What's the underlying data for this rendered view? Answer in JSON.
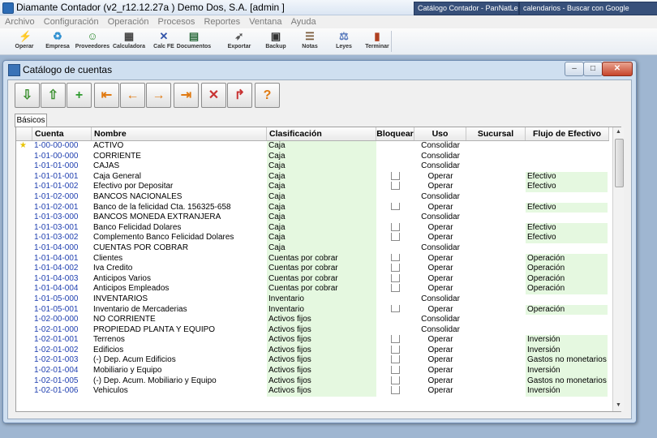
{
  "app": {
    "title": "Diamante Contador (v2_r12.12.27a ) Demo Dos, S.A.  [admin ]",
    "browser_tabs": [
      "Catálogo Contador - PanNatLeo...",
      "calendarios - Buscar con Google"
    ]
  },
  "menu": [
    "Archivo",
    "Configuración",
    "Operación",
    "Procesos",
    "Reportes",
    "Ventana",
    "Ayuda"
  ],
  "toolbar": [
    {
      "label": "Operar",
      "icon": "lightning-icon"
    },
    {
      "label": "Empresa",
      "icon": "recycle-icon"
    },
    {
      "label": "Proveedores",
      "icon": "person-icon"
    },
    {
      "label": "Calculadora",
      "icon": "calculator-icon"
    },
    {
      "label": "Calc FE",
      "icon": "xy-icon"
    },
    {
      "label": "Documentos",
      "icon": "documents-icon"
    },
    {
      "label": "Exportar",
      "icon": "export-icon"
    },
    {
      "label": "Backup",
      "icon": "floppy-icon"
    },
    {
      "label": "Notas",
      "icon": "notes-icon"
    },
    {
      "label": "Leyes",
      "icon": "laws-icon"
    },
    {
      "label": "Terminar",
      "icon": "exit-door-icon"
    }
  ],
  "window": {
    "title": "Catálogo de cuentas",
    "controls": {
      "minimize": "–",
      "maximize": "□",
      "close": "✕"
    }
  },
  "icon_buttons": [
    {
      "name": "import-icon",
      "glyph": "⇩",
      "color": "#3a8f2e"
    },
    {
      "name": "export-icon",
      "glyph": "⇧",
      "color": "#3a8f2e"
    },
    {
      "name": "new-document-icon",
      "glyph": "+",
      "color": "#2e9a2e"
    },
    {
      "name": "first-record-icon",
      "glyph": "⇤",
      "color": "#e07a12"
    },
    {
      "name": "previous-record-icon",
      "glyph": "←",
      "color": "#e07a12"
    },
    {
      "name": "next-record-icon",
      "glyph": "→",
      "color": "#e07a12"
    },
    {
      "name": "last-record-icon",
      "glyph": "⇥",
      "color": "#e07a12"
    },
    {
      "name": "delete-icon",
      "glyph": "✕",
      "color": "#c83232"
    },
    {
      "name": "exit-icon",
      "glyph": "↱",
      "color": "#c83232"
    },
    {
      "name": "help-icon",
      "glyph": "?",
      "color": "#e07a12"
    }
  ],
  "tab_label": "Básicos",
  "columns": [
    "Cuenta",
    "Nombre",
    "Clasificación",
    "Bloquear",
    "Uso",
    "Sucursal",
    "Flujo de Efectivo"
  ],
  "rows": [
    {
      "cuenta": "1-00-00-000",
      "nombre": "ACTIVO",
      "clasificacion": "Caja",
      "bloquear": false,
      "uso": "Consolidar",
      "flujo": "",
      "current": true
    },
    {
      "cuenta": "1-01-00-000",
      "nombre": "CORRIENTE",
      "clasificacion": "Caja",
      "bloquear": false,
      "uso": "Consolidar",
      "flujo": ""
    },
    {
      "cuenta": "1-01-01-000",
      "nombre": "CAJAS",
      "clasificacion": "Caja",
      "bloquear": false,
      "uso": "Consolidar",
      "flujo": ""
    },
    {
      "cuenta": "1-01-01-001",
      "nombre": "Caja General",
      "clasificacion": "Caja",
      "bloquear": true,
      "uso": "Operar",
      "flujo": "Efectivo"
    },
    {
      "cuenta": "1-01-01-002",
      "nombre": "Efectivo por Depositar",
      "clasificacion": "Caja",
      "bloquear": true,
      "uso": "Operar",
      "flujo": "Efectivo"
    },
    {
      "cuenta": "1-01-02-000",
      "nombre": "BANCOS NACIONALES",
      "clasificacion": "Caja",
      "bloquear": false,
      "uso": "Consolidar",
      "flujo": ""
    },
    {
      "cuenta": "1-01-02-001",
      "nombre": "Banco de la felicidad Cta. 156325-658",
      "clasificacion": "Caja",
      "bloquear": true,
      "uso": "Operar",
      "flujo": "Efectivo"
    },
    {
      "cuenta": "1-01-03-000",
      "nombre": "BANCOS MONEDA EXTRANJERA",
      "clasificacion": "Caja",
      "bloquear": false,
      "uso": "Consolidar",
      "flujo": ""
    },
    {
      "cuenta": "1-01-03-001",
      "nombre": "Banco Felicidad Dolares",
      "clasificacion": "Caja",
      "bloquear": true,
      "uso": "Operar",
      "flujo": "Efectivo"
    },
    {
      "cuenta": "1-01-03-002",
      "nombre": "Complemento Banco Felicidad Dolares",
      "clasificacion": "Caja",
      "bloquear": true,
      "uso": "Operar",
      "flujo": "Efectivo"
    },
    {
      "cuenta": "1-01-04-000",
      "nombre": "CUENTAS POR COBRAR",
      "clasificacion": "Caja",
      "bloquear": false,
      "uso": "Consolidar",
      "flujo": ""
    },
    {
      "cuenta": "1-01-04-001",
      "nombre": "Clientes",
      "clasificacion": "Cuentas por cobrar",
      "bloquear": true,
      "uso": "Operar",
      "flujo": "Operación"
    },
    {
      "cuenta": "1-01-04-002",
      "nombre": "Iva Credito",
      "clasificacion": "Cuentas por cobrar",
      "bloquear": true,
      "uso": "Operar",
      "flujo": "Operación"
    },
    {
      "cuenta": "1-01-04-003",
      "nombre": "Anticipos Varios",
      "clasificacion": "Cuentas por cobrar",
      "bloquear": true,
      "uso": "Operar",
      "flujo": "Operación"
    },
    {
      "cuenta": "1-01-04-004",
      "nombre": "Anticipos Empleados",
      "clasificacion": "Cuentas por cobrar",
      "bloquear": true,
      "uso": "Operar",
      "flujo": "Operación"
    },
    {
      "cuenta": "1-01-05-000",
      "nombre": "INVENTARIOS",
      "clasificacion": "Inventario",
      "bloquear": false,
      "uso": "Consolidar",
      "flujo": ""
    },
    {
      "cuenta": "1-01-05-001",
      "nombre": "Inventario de Mercaderias",
      "clasificacion": "Inventario",
      "bloquear": true,
      "uso": "Operar",
      "flujo": "Operación"
    },
    {
      "cuenta": "1-02-00-000",
      "nombre": "NO CORRIENTE",
      "clasificacion": "Activos fijos",
      "bloquear": false,
      "uso": "Consolidar",
      "flujo": ""
    },
    {
      "cuenta": "1-02-01-000",
      "nombre": "PROPIEDAD PLANTA Y EQUIPO",
      "clasificacion": "Activos fijos",
      "bloquear": false,
      "uso": "Consolidar",
      "flujo": ""
    },
    {
      "cuenta": "1-02-01-001",
      "nombre": "Terrenos",
      "clasificacion": "Activos fijos",
      "bloquear": true,
      "uso": "Operar",
      "flujo": "Inversión"
    },
    {
      "cuenta": "1-02-01-002",
      "nombre": "Edificios",
      "clasificacion": "Activos fijos",
      "bloquear": true,
      "uso": "Operar",
      "flujo": "Inversión"
    },
    {
      "cuenta": "1-02-01-003",
      "nombre": "(-) Dep. Acum Edificios",
      "clasificacion": "Activos fijos",
      "bloquear": true,
      "uso": "Operar",
      "flujo": "Gastos no monetarios"
    },
    {
      "cuenta": "1-02-01-004",
      "nombre": "Mobiliario y Equipo",
      "clasificacion": "Activos fijos",
      "bloquear": true,
      "uso": "Operar",
      "flujo": "Inversión"
    },
    {
      "cuenta": "1-02-01-005",
      "nombre": "(-) Dep. Acum. Mobiliario y Equipo",
      "clasificacion": "Activos fijos",
      "bloquear": true,
      "uso": "Operar",
      "flujo": "Gastos no monetarios"
    },
    {
      "cuenta": "1-02-01-006",
      "nombre": "Vehiculos",
      "clasificacion": "Activos fijos",
      "bloquear": true,
      "uso": "Operar",
      "flujo": "Inversión"
    }
  ],
  "colors": {
    "green_cell": "#e5f8e0",
    "code_text": "#1f3fb0",
    "window_frame": "#cfdff0"
  }
}
